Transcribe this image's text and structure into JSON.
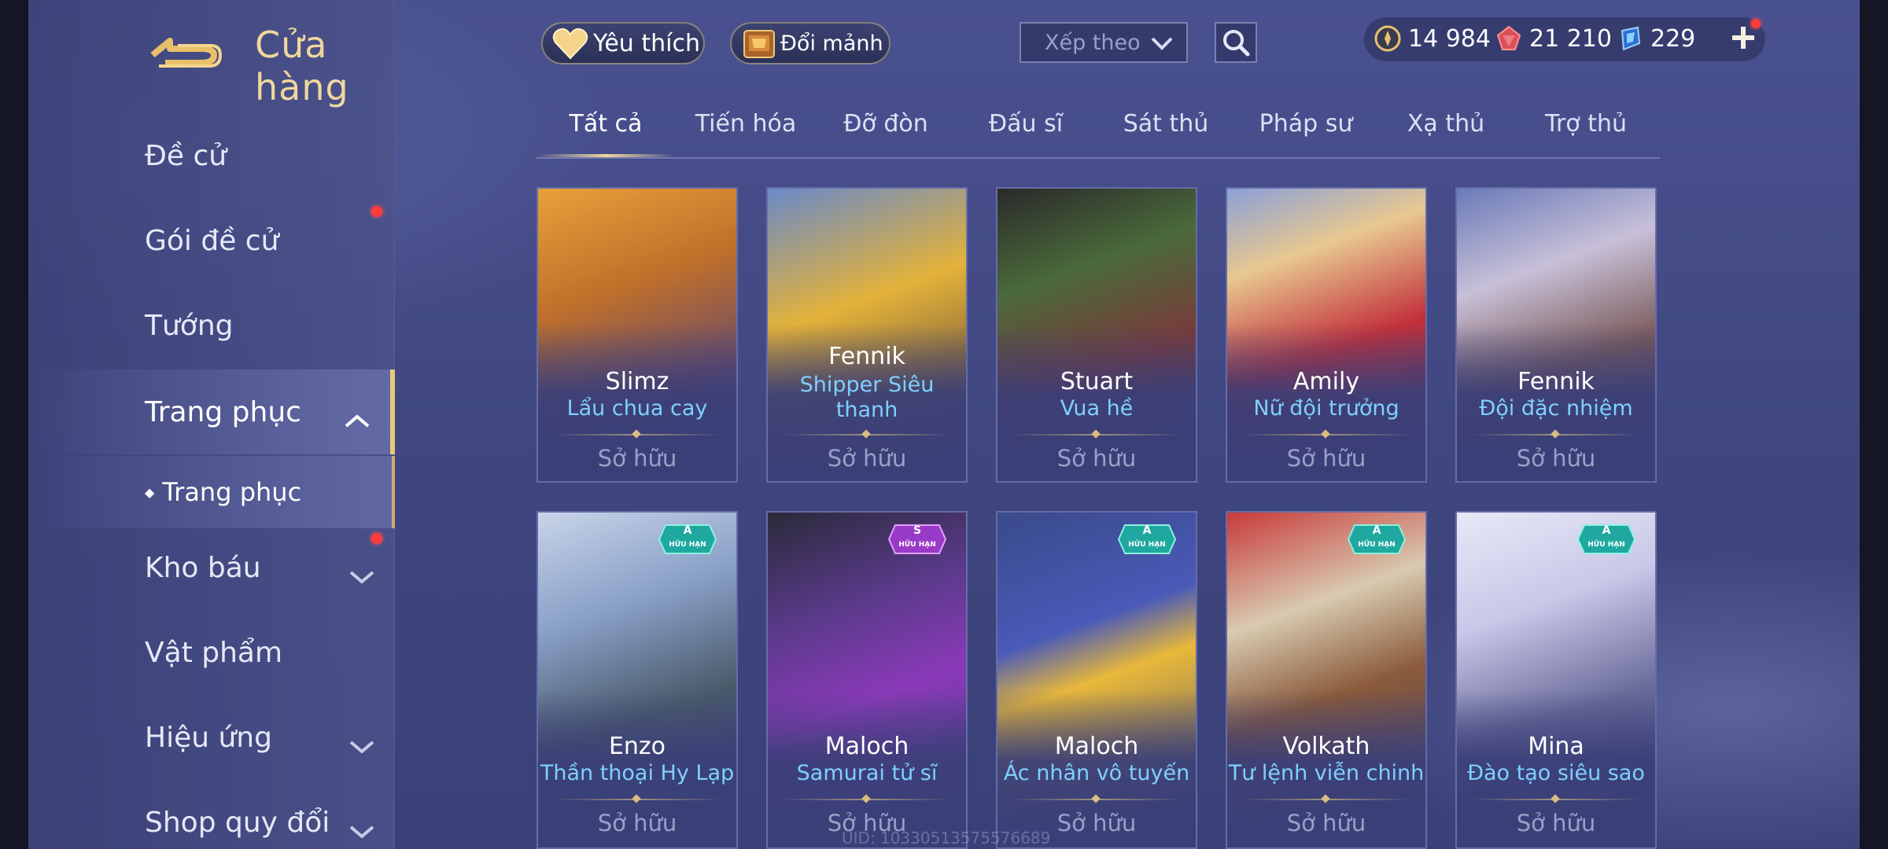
{
  "header": {
    "title": "Cửa hàng"
  },
  "topbar": {
    "favorites_label": "Yêu thích",
    "exchange_label": "Đổi mảnh",
    "sort_label": "Xếp theo",
    "currencies": [
      {
        "name": "gold-coin",
        "value": "14 984",
        "color": "#e8c36a"
      },
      {
        "name": "voucher-gem",
        "value": "21 210",
        "color": "#e05a5a"
      },
      {
        "name": "quan-huy",
        "value": "229",
        "color": "#6ab8ff"
      }
    ]
  },
  "sidebar": {
    "items": [
      {
        "label": "Đề cử"
      },
      {
        "label": "Gói đề cử"
      },
      {
        "label": "Tướng"
      },
      {
        "label": "Trang phục"
      },
      {
        "label": "Trang phục"
      },
      {
        "label": "Kho báu"
      },
      {
        "label": "Vật phẩm"
      },
      {
        "label": "Hiệu ứng"
      },
      {
        "label": "Shop quy đổi"
      }
    ]
  },
  "tabs": [
    "Tất cả",
    "Tiến hóa",
    "Đỡ đòn",
    "Đấu sĩ",
    "Sát thủ",
    "Pháp sư",
    "Xạ thủ",
    "Trợ thủ"
  ],
  "cards": [
    {
      "hero": "Slimz",
      "skin": "Lẩu chua cay",
      "status": "Sở hữu",
      "colors": [
        "#e89a3a",
        "#7a4a2a"
      ]
    },
    {
      "hero": "Fennik",
      "skin": "Shipper Siêu",
      "skin2": "thanh",
      "status": "Sở hữu",
      "colors": [
        "#e3b23a",
        "#4a6aa8"
      ]
    },
    {
      "hero": "Stuart",
      "skin": "Vua hề",
      "status": "Sở hữu",
      "colors": [
        "#2a3a2a",
        "#6a3a3a"
      ]
    },
    {
      "hero": "Amily",
      "skin": "Nữ đội trưởng",
      "status": "Sở hữu",
      "colors": [
        "#c2303a",
        "#6a7ab8"
      ]
    },
    {
      "hero": "Fennik",
      "skin": "Đội đặc nhiệm",
      "status": "Sở hữu",
      "colors": [
        "#6a5a8a",
        "#8a6a5a"
      ]
    },
    {
      "hero": "Enzo",
      "skin": "Thần thoại Hy Lạp",
      "status": "Sở hữu",
      "badge_tier": "A",
      "badge_text": "HỮU HẠN",
      "colors": [
        "#8aa0c8",
        "#3a5a3a"
      ]
    },
    {
      "hero": "Maloch",
      "skin": "Samurai tử sĩ",
      "status": "Sở hữu",
      "badge_tier": "S",
      "badge_text": "HỮU HẠN",
      "colors": [
        "#3a3a6a",
        "#8a3ab8"
      ]
    },
    {
      "hero": "Maloch",
      "skin": "Ác nhân vô tuyến",
      "status": "Sở hữu",
      "badge_tier": "A",
      "badge_text": "HỮU HẠN",
      "colors": [
        "#4a5ab8",
        "#e8b83a"
      ]
    },
    {
      "hero": "Volkath",
      "skin": "Tư lệnh viễn chinh",
      "status": "Sở hữu",
      "badge_tier": "A",
      "badge_text": "HỮU HẠN",
      "colors": [
        "#7a2a2a",
        "#d8cab0"
      ]
    },
    {
      "hero": "Mina",
      "skin": "Đào tạo siêu sao",
      "status": "Sở hữu",
      "badge_tier": "A",
      "badge_text": "HỮU HẠN",
      "colors": [
        "#c8c8e8",
        "#4a4a6a"
      ]
    }
  ],
  "footer": {
    "uid": "UID: 1033051357557668​9"
  }
}
